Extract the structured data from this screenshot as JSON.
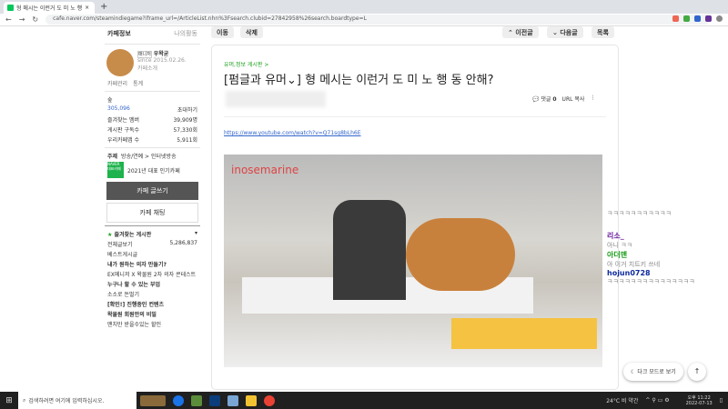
{
  "browser": {
    "tab_title": "형 메시는 이런거 도 미 노 행",
    "url": "cafe.naver.com/steamindiegame?iframe_url=/ArticleList.nhn%3Fsearch.clubid=27842958%26search.boardtype=L"
  },
  "sidebar": {
    "tab_info": "카페정보",
    "tab_activity": "나의활동",
    "manager_badge": "매니저",
    "manager": "우왁굳",
    "since": "since 2015.02.26.",
    "intro": "카페소개",
    "manage": "카페관리",
    "stats": "통계",
    "level": "숲",
    "members": "305,096",
    "invite": "초대하기",
    "stats_rows": [
      {
        "label": "즐겨찾는 멤버",
        "value": "39,909명"
      },
      {
        "label": "게시판 구독수",
        "value": "57,330회"
      },
      {
        "label": "우리카페앱 수",
        "value": "5,911회"
      }
    ],
    "topic_label": "주제",
    "topic": "방송/연예 > 인터넷방송",
    "award_badge": "NAVER 대표카페",
    "award": "2021년 대표 인기카페",
    "write": "카페 글쓰기",
    "chat": "카페 채팅",
    "fav_boards": "즐겨찾는 게시판",
    "all_posts": "전체글보기",
    "all_count": "5,286,837",
    "best": "베스트게시글",
    "sec1": "내가 원하는 의자 만들기?",
    "item1": "EX메니저 X 왁물원 2차 의자 콘테스트",
    "sec2": "누구나 할 수 있는 부업",
    "item2": "소소로 돈벌기",
    "sec3": "[확인!] 진행중인 컨텐츠",
    "sec4": "왁물원 회원만의 비밀",
    "item4": "맨치만 받을수있는 할인"
  },
  "toolbar": {
    "move": "이동",
    "delete": "삭제",
    "prev": "이전글",
    "next": "다음글",
    "list": "목록"
  },
  "article": {
    "board": "유머,정보 게시판 >",
    "title": "[펌글과 유머⌄] 형 메시는 이런거 도 미 노 행 동 안해?",
    "comments_label": "댓글",
    "comments": "0",
    "url_copy": "URL 복사",
    "link": "https://www.youtube.com/watch?v=Q71sg8bLh6E",
    "watermark": "inosemarine"
  },
  "chat": [
    {
      "name": "",
      "msg": "ㅋㅋㅋㅋㅋㅋㅋㅋㅋㅋㅋ",
      "color": "#bbb"
    },
    {
      "name": "리소_",
      "msg": "아니 ㅋㅋ",
      "color": "#6a1b9a"
    },
    {
      "name": "아더맨",
      "msg": "아 이거 치트키 쓰네",
      "color": "#1a9e1a"
    },
    {
      "name": "hojun0728",
      "msg": "ㅋㅋㅋㅋㅋㅋㅋㅋㅋㅋㅋㅋㅋㅋㅋ",
      "color": "#0d2a9e"
    }
  ],
  "floating": {
    "dark_mode": "다크 모드로 보기"
  },
  "taskbar": {
    "search": "검색하려면 여기에 입력하십시오.",
    "weather": "24°C 비 약간",
    "time": "오후 11:22",
    "date": "2022-07-13"
  }
}
